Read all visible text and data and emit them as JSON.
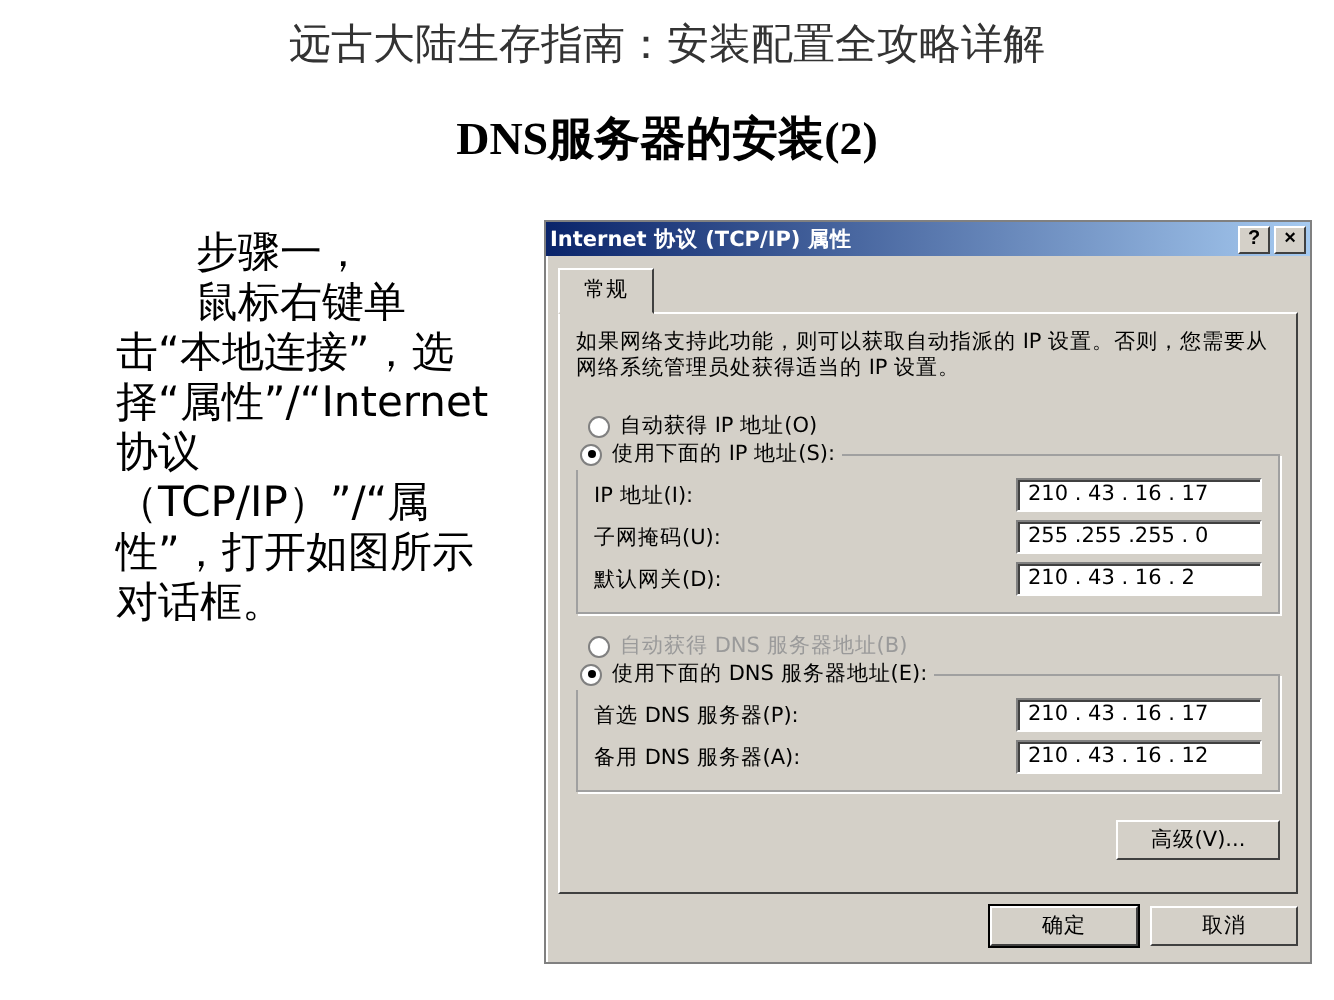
{
  "page_title": "远古大陆生存指南：安装配置全攻略详解",
  "slide": {
    "title": "DNS服务器的安装(2)",
    "step": "步骤一，",
    "instruction": "鼠标右键单击“本地连接”，选择“属性”/“Internet协议（TCP/IP）”/“属性”，打开如图所示对话框。",
    "dialog": {
      "title": "Internet 协议 (TCP/IP) 属性",
      "help": "?",
      "close": "×",
      "tabs": [
        {
          "label": "常规",
          "selected": true
        }
      ],
      "intro": "如果网络支持此功能，则可以获取自动指派的 IP 设置。否则，您需要从网络系统管理员处获得适当的 IP 设置。",
      "sections": [
        {
          "auto": {
            "label": "自动获得 IP 地址(O)",
            "selected": false,
            "disabled": false
          },
          "manual": {
            "label": "使用下面的 IP 地址(S):",
            "selected": true,
            "disabled": false
          },
          "fields": [
            {
              "label": "IP 地址(I):",
              "value": "210 . 43 . 16 . 17"
            },
            {
              "label": "子网掩码(U):",
              "value": "255 .255 .255 . 0"
            },
            {
              "label": "默认网关(D):",
              "value": "210 . 43 . 16 . 2"
            }
          ]
        },
        {
          "auto": {
            "label": "自动获得 DNS 服务器地址(B)",
            "selected": false,
            "disabled": true
          },
          "manual": {
            "label": "使用下面的 DNS 服务器地址(E):",
            "selected": true,
            "disabled": false
          },
          "fields": [
            {
              "label": "首选 DNS 服务器(P):",
              "value": "210 . 43 . 16 . 17"
            },
            {
              "label": "备用 DNS 服务器(A):",
              "value": "210 . 43 . 16 . 12"
            }
          ]
        }
      ],
      "advanced": "高级(V)...",
      "buttons": [
        {
          "label": "确定",
          "default": true
        },
        {
          "label": "取消",
          "default": false
        }
      ]
    }
  }
}
